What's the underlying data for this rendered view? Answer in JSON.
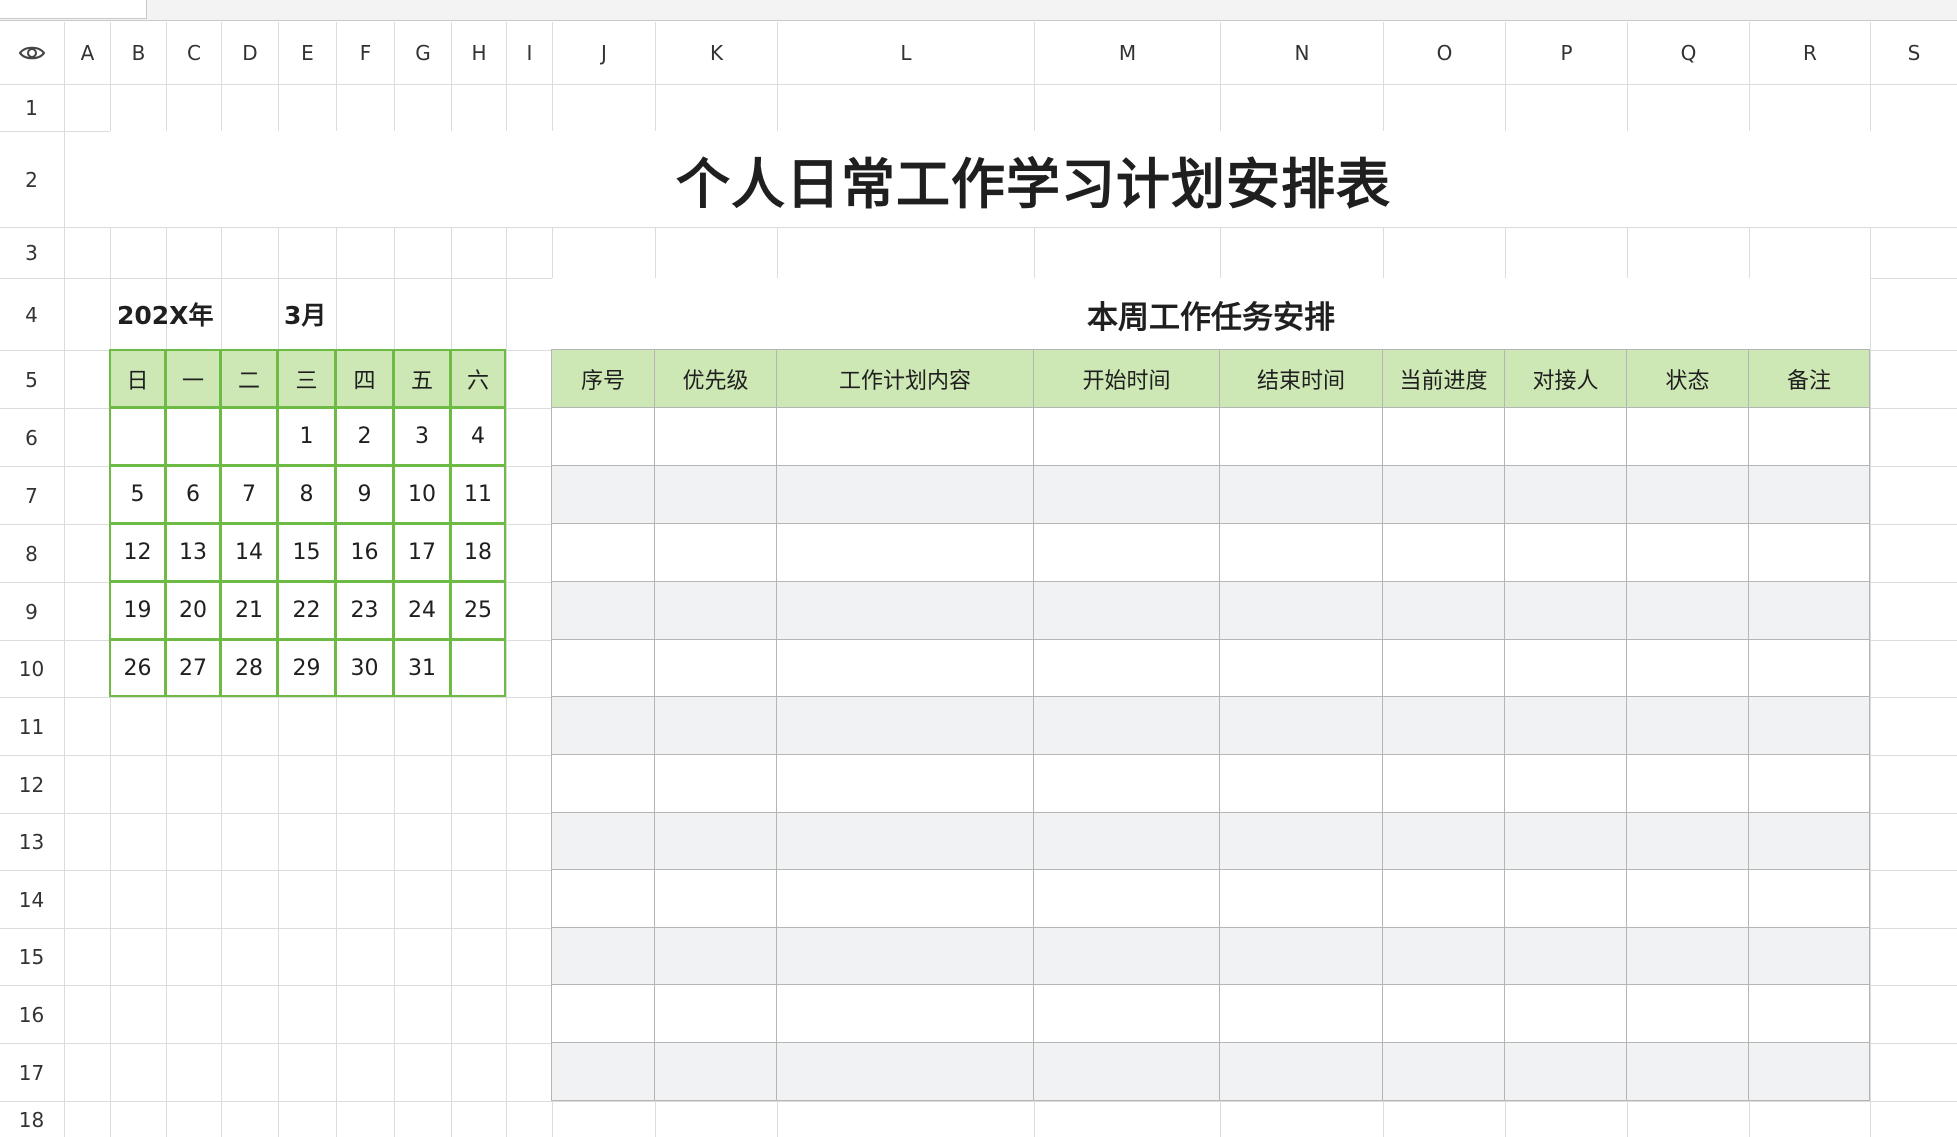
{
  "title": "个人日常工作学习计划安排表",
  "columns": [
    "A",
    "B",
    "C",
    "D",
    "E",
    "F",
    "G",
    "H",
    "I",
    "J",
    "K",
    "L",
    "M",
    "N",
    "O",
    "P",
    "Q",
    "R",
    "S"
  ],
  "rows": [
    "1",
    "2",
    "3",
    "4",
    "5",
    "6",
    "7",
    "8",
    "9",
    "10",
    "11",
    "12",
    "13",
    "14",
    "15",
    "16",
    "17",
    "18"
  ],
  "calendar": {
    "year_label": "202X年",
    "month_label": "3月",
    "weekdays": [
      "日",
      "一",
      "二",
      "三",
      "四",
      "五",
      "六"
    ],
    "weeks": [
      [
        "",
        "",
        "",
        "1",
        "2",
        "3",
        "4"
      ],
      [
        "5",
        "6",
        "7",
        "8",
        "9",
        "10",
        "11"
      ],
      [
        "12",
        "13",
        "14",
        "15",
        "16",
        "17",
        "18"
      ],
      [
        "19",
        "20",
        "21",
        "22",
        "23",
        "24",
        "25"
      ],
      [
        "26",
        "27",
        "28",
        "29",
        "30",
        "31",
        ""
      ]
    ]
  },
  "tasks": {
    "title": "本周工作任务安排",
    "headers": [
      "序号",
      "优先级",
      "工作计划内容",
      "开始时间",
      "结束时间",
      "当前进度",
      "对接人",
      "状态",
      "备注"
    ]
  },
  "colors": {
    "header_fill": "#cde7b5",
    "calendar_border": "#6dbb45",
    "alt_row": "#f1f2f4",
    "grid": "#dcdcdc"
  }
}
